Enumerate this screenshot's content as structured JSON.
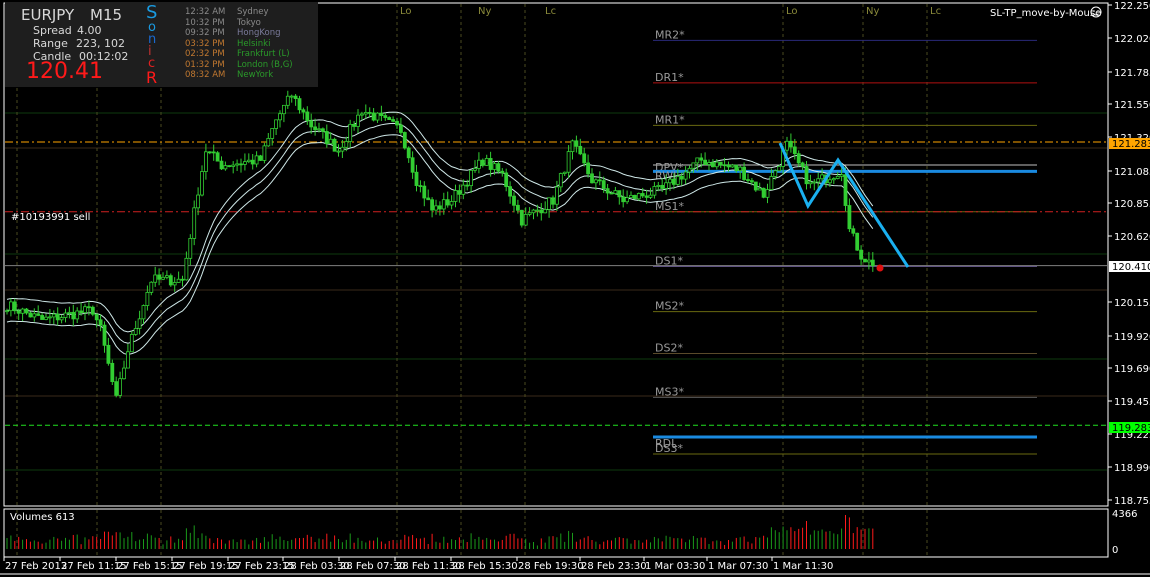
{
  "info": {
    "symbol": "EURJPY",
    "timeframe": "M15",
    "spread_label": "Spread",
    "spread": "4.00",
    "range_label": "Range",
    "range": "223, 102",
    "candle_label": "Candle",
    "candle": "00:12:02",
    "price": "120.41",
    "sonic": [
      "S",
      "o",
      "n",
      "i",
      "c",
      "R"
    ],
    "clocks": [
      {
        "time": "12:32 AM",
        "city": "Sydney",
        "tc": "#8a8a8a",
        "cc": "#8a8a8a"
      },
      {
        "time": "10:32 PM",
        "city": "Tokyo",
        "tc": "#8a8a8a",
        "cc": "#8a8a8a"
      },
      {
        "time": "09:32 PM",
        "city": "HongKong",
        "tc": "#8a8a8a",
        "cc": "#7a7a9a"
      },
      {
        "time": "03:32 PM",
        "city": "Helsinki",
        "tc": "#c07830",
        "cc": "#2a9a2a"
      },
      {
        "time": "02:32 PM",
        "city": "Frankfurt  (L)",
        "tc": "#c07830",
        "cc": "#2a9a2a"
      },
      {
        "time": "01:32 PM",
        "city": "London  (B,G)",
        "tc": "#c07830",
        "cc": "#2a9a2a"
      },
      {
        "time": "08:32 AM",
        "city": "NewYork",
        "tc": "#c07830",
        "cc": "#2a9a2a"
      }
    ]
  },
  "indicator_title": "SL-TP_move-by-Mouse",
  "order_label": "#10193991 sell",
  "sessions": [
    "Lo",
    "Ny",
    "Lc",
    "Lo",
    "Ny",
    "Lc"
  ],
  "price_axis": [
    "122.250",
    "122.020",
    "121.785",
    "121.550",
    "121.320",
    "121.085",
    "120.855",
    "120.620",
    "120.155",
    "119.920",
    "119.690",
    "119.455",
    "119.225",
    "118.990",
    "118.755"
  ],
  "price_tags": {
    "upper": "121.283",
    "current": "120.410",
    "lower": "119.283"
  },
  "pivots": [
    {
      "label": "MR2*",
      "price": 122.0,
      "color": "#2a2a7a"
    },
    {
      "label": "DR1*",
      "price": 121.7,
      "color": "#b01010"
    },
    {
      "label": "MR1*",
      "price": 121.4,
      "color": "#6a6a10"
    },
    {
      "label": "DPV*",
      "price": 121.12,
      "color": "#c0c0c0"
    },
    {
      "label": "RWL",
      "price": 121.075,
      "color": "#1a8ae0"
    },
    {
      "label": "MS1*",
      "price": 120.79,
      "color": "#6a6a10"
    },
    {
      "label": "DS1*",
      "price": 120.405,
      "color": "#6a5a9a"
    },
    {
      "label": "MS2*",
      "price": 120.085,
      "color": "#6a6a10"
    },
    {
      "label": "DS2*",
      "price": 119.79,
      "color": "#5a4a2a"
    },
    {
      "label": "MS3*",
      "price": 119.48,
      "color": "#5a5a5a"
    },
    {
      "label": "RDL",
      "price": 119.2,
      "color": "#1a8ae0"
    },
    {
      "label": "DS3*",
      "price": 119.08,
      "color": "#6a6a10"
    }
  ],
  "volumes": {
    "label": "Volumes 613",
    "max": "4366",
    "min": "0"
  },
  "dates": [
    "27 Feb 2013",
    "27 Feb 11:15",
    "27 Feb 15:15",
    "27 Feb 19:15",
    "27 Feb 23:15",
    "28 Feb 03:30",
    "28 Feb 07:30",
    "28 Feb 11:30",
    "28 Feb 15:30",
    "28 Feb 19:30",
    "28 Feb 23:30",
    "1 Mar 03:30",
    "1 Mar 07:30",
    "1 Mar 11:30"
  ],
  "chart_data": {
    "type": "candlestick",
    "symbol": "EURJPY",
    "timeframe": "M15",
    "ylim": [
      118.755,
      122.25
    ],
    "close_waypoints": [
      [
        0,
        120.132
      ],
      [
        9,
        120.026
      ],
      [
        22,
        120.097
      ],
      [
        24,
        119.956
      ],
      [
        28,
        119.461
      ],
      [
        31,
        119.815
      ],
      [
        37,
        120.309
      ],
      [
        45,
        120.309
      ],
      [
        49,
        120.944
      ],
      [
        51,
        121.226
      ],
      [
        55,
        121.12
      ],
      [
        65,
        121.156
      ],
      [
        69,
        121.438
      ],
      [
        73,
        121.615
      ],
      [
        78,
        121.403
      ],
      [
        85,
        121.226
      ],
      [
        91,
        121.509
      ],
      [
        101,
        121.368
      ],
      [
        105,
        121.015
      ],
      [
        109,
        120.803
      ],
      [
        114,
        120.873
      ],
      [
        122,
        121.156
      ],
      [
        127,
        121.05
      ],
      [
        132,
        120.732
      ],
      [
        140,
        120.873
      ],
      [
        145,
        121.262
      ],
      [
        150,
        121.015
      ],
      [
        158,
        120.873
      ],
      [
        168,
        120.944
      ],
      [
        178,
        121.156
      ],
      [
        188,
        121.085
      ],
      [
        194,
        120.909
      ],
      [
        200,
        121.262
      ],
      [
        206,
        120.979
      ],
      [
        214,
        121.085
      ],
      [
        216,
        120.662
      ],
      [
        219,
        120.485
      ],
      [
        222,
        120.41
      ]
    ],
    "levels": {
      "buy_line": 121.283,
      "sell_order": 120.79,
      "bid": 120.41,
      "lower_line": 119.283
    }
  }
}
